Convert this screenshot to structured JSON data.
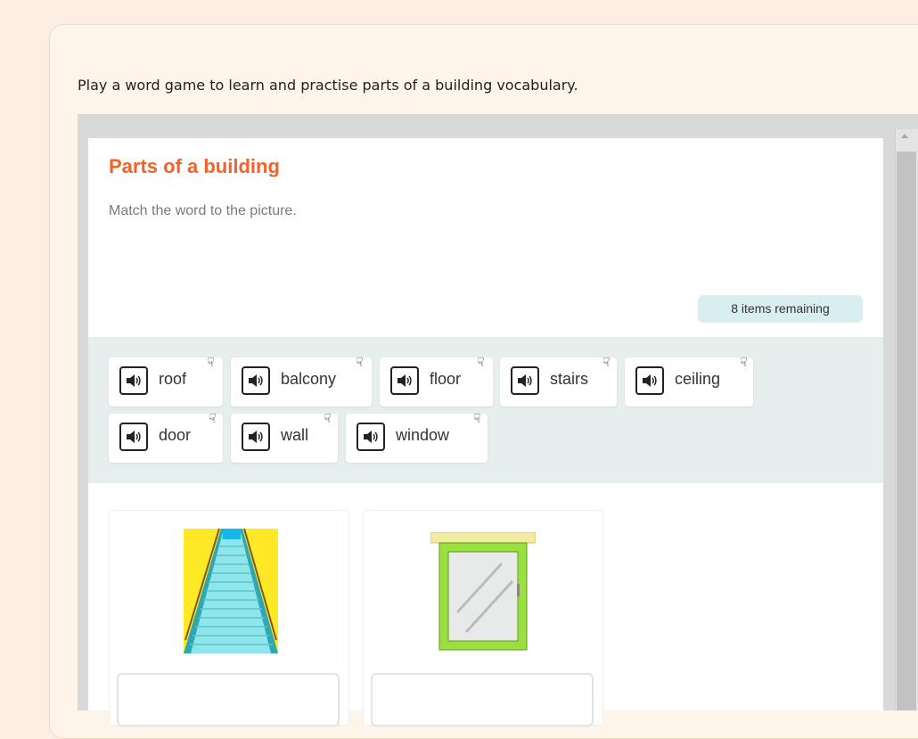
{
  "page": {
    "intro": "Play a word game to learn and practise parts of a building vocabulary."
  },
  "game": {
    "title": "Parts of a building",
    "instruction": "Match the word to the picture.",
    "remaining": "8 items remaining",
    "words": [
      "roof",
      "balcony",
      "floor",
      "stairs",
      "ceiling",
      "door",
      "wall",
      "window"
    ],
    "pictures": [
      "stairs-picture",
      "window-picture"
    ]
  },
  "colors": {
    "accent": "#f0632a",
    "page_bg": "#fdeee3",
    "tray_bg": "#e7eeee",
    "badge_bg": "#d9eef0"
  },
  "icons": [
    "speaker-icon",
    "drag-hand-icon",
    "scroll-up-arrow"
  ]
}
